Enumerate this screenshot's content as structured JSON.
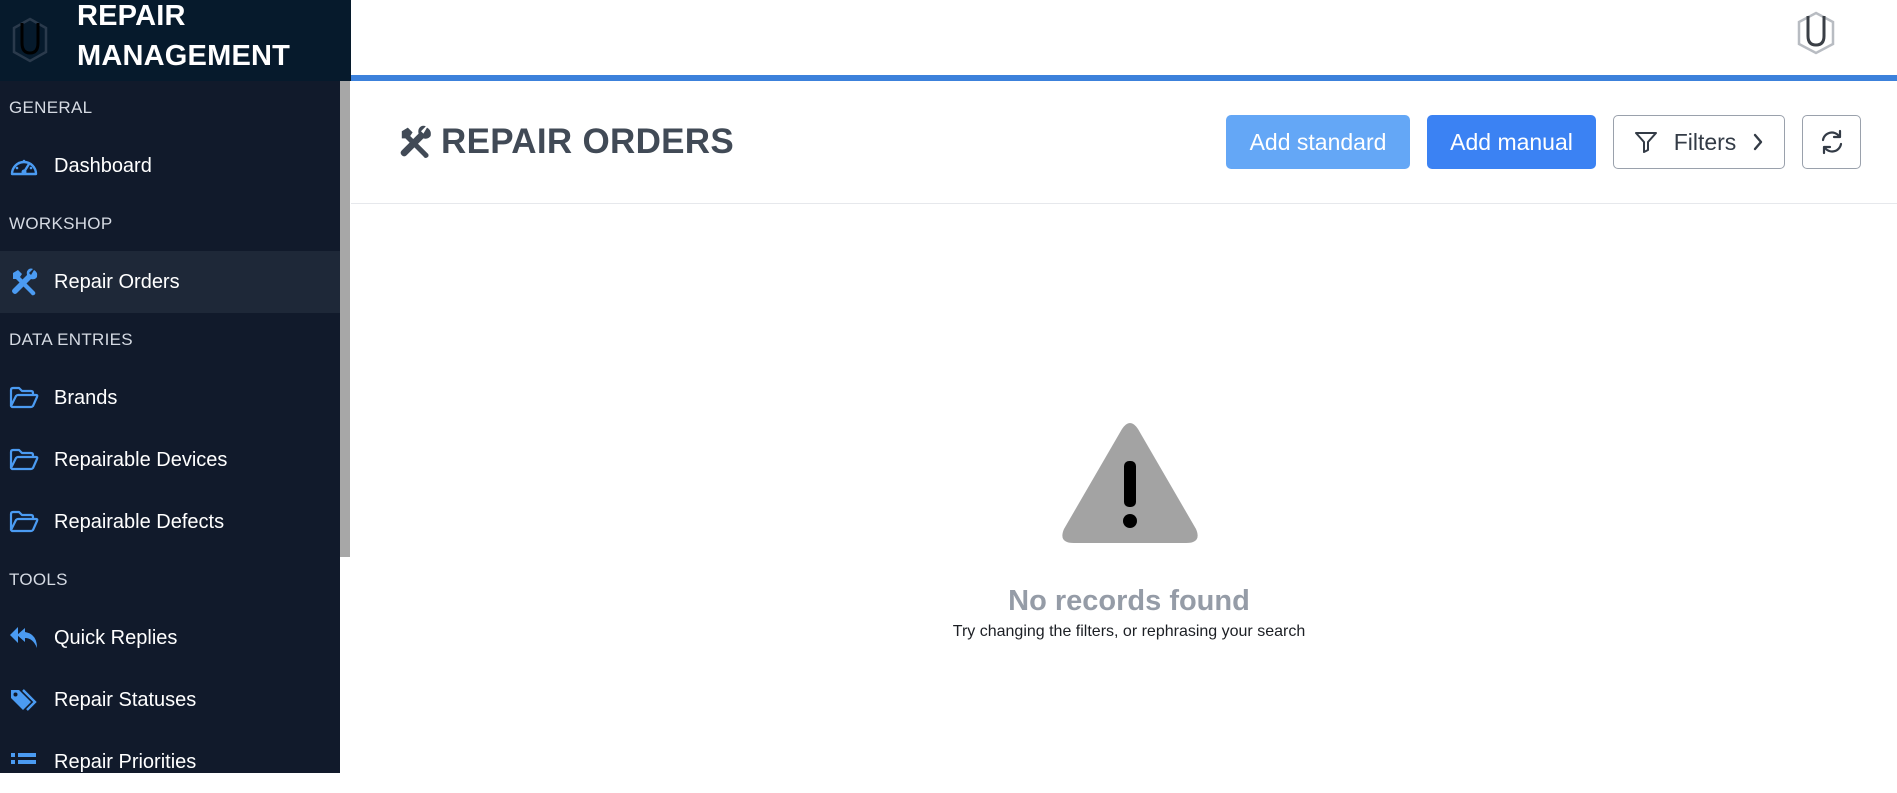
{
  "brand": {
    "title_line1": "REPAIR",
    "title_line2": "MANAGEMENT",
    "logo_icon": "u-hex-logo-icon"
  },
  "sidebar": {
    "sections": [
      {
        "heading": "GENERAL",
        "items": [
          {
            "label": "Dashboard",
            "icon": "gauge-icon",
            "active": false
          }
        ]
      },
      {
        "heading": "WORKSHOP",
        "items": [
          {
            "label": "Repair Orders",
            "icon": "tools-icon",
            "active": true
          }
        ]
      },
      {
        "heading": "DATA ENTRIES",
        "items": [
          {
            "label": "Brands",
            "icon": "folder-open-icon",
            "active": false
          },
          {
            "label": "Repairable Devices",
            "icon": "folder-open-icon",
            "active": false
          },
          {
            "label": "Repairable Defects",
            "icon": "folder-open-icon",
            "active": false
          }
        ]
      },
      {
        "heading": "TOOLS",
        "items": [
          {
            "label": "Quick Replies",
            "icon": "reply-all-icon",
            "active": false
          },
          {
            "label": "Repair Statuses",
            "icon": "tags-icon",
            "active": false
          },
          {
            "label": "Repair Priorities",
            "icon": "list-icon",
            "active": false
          }
        ]
      }
    ]
  },
  "header": {
    "title": "REPAIR ORDERS",
    "add_standard": "Add standard",
    "add_manual": "Add manual",
    "filters": "Filters"
  },
  "empty_state": {
    "title": "No records found",
    "subtitle": "Try changing the filters, or rephrasing your search"
  },
  "colors": {
    "sidebar_bg": "#111a2b",
    "accent": "#3c81db",
    "icon_blue": "#4b9bf2",
    "btn_primary": "#3b82f3",
    "btn_light": "#64a7f6"
  }
}
